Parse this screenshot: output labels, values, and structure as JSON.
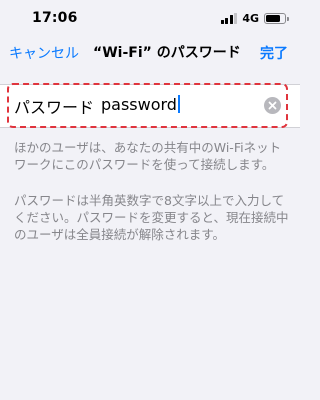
{
  "status_bar": {
    "time": "17:06",
    "network": "4G",
    "signal_level": "3 of 4",
    "battery_level": 0.75
  },
  "nav": {
    "cancel_label": "キャンセル",
    "title": "“Wi-Fi” のパスワード",
    "done_label": "完了"
  },
  "password_field": {
    "label": "パスワード",
    "value": "password",
    "clear_icon": "clear-circle-x-icon"
  },
  "help": {
    "paragraph_1": "ほかのユーザは、あなたの共有中のWi-Fiネットワークにこのパスワードを使って接続します。",
    "paragraph_2": "パスワードは半角英数字で8文字以上で入力してください。パスワードを変更すると、現在接続中のユーザは全員接続が解除されます。"
  },
  "colors": {
    "accent": "#0a7aff",
    "highlight": "#e0343d",
    "background": "#f2f2f7",
    "secondary_text": "#86868b"
  }
}
